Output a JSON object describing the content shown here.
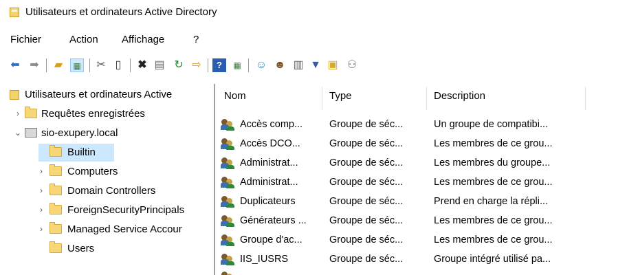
{
  "window": {
    "title": "Utilisateurs et ordinateurs Active Directory"
  },
  "menu": [
    "Fichier",
    "Action",
    "Affichage",
    "?"
  ],
  "toolbar": {
    "icons": [
      "back-arrow-icon",
      "forward-arrow-icon",
      "up-folder-icon",
      "show-tree-icon",
      "cut-icon",
      "paste-icon",
      "delete-icon",
      "properties-icon",
      "refresh-icon",
      "export-icon",
      "help-icon",
      "show-console-icon",
      "new-user-icon",
      "new-group-icon",
      "new-ou-icon",
      "filter-icon",
      "find-icon",
      "add-to-group-icon"
    ]
  },
  "tree": {
    "root": "Utilisateurs et ordinateurs Active",
    "saved_queries": "Requêtes enregistrées",
    "domain": "sio-exupery.local",
    "items": [
      "Builtin",
      "Computers",
      "Domain Controllers",
      "ForeignSecurityPrincipals",
      "Managed Service Accour",
      "Users"
    ],
    "selected": "Builtin"
  },
  "list": {
    "columns": [
      "Nom",
      "Type",
      "Description"
    ],
    "rows": [
      {
        "name": "Accès comp...",
        "type": "Groupe de séc...",
        "desc": "Un groupe de compatibi..."
      },
      {
        "name": "Accès DCO...",
        "type": "Groupe de séc...",
        "desc": "Les membres de ce grou..."
      },
      {
        "name": "Administrat...",
        "type": "Groupe de séc...",
        "desc": "Les membres du groupe..."
      },
      {
        "name": "Administrat...",
        "type": "Groupe de séc...",
        "desc": "Les membres de ce grou..."
      },
      {
        "name": "Duplicateurs",
        "type": "Groupe de séc...",
        "desc": "Prend en charge la répli..."
      },
      {
        "name": "Générateurs ...",
        "type": "Groupe de séc...",
        "desc": "Les membres de ce grou..."
      },
      {
        "name": "Groupe d'ac...",
        "type": "Groupe de séc...",
        "desc": "Les membres de ce grou..."
      },
      {
        "name": "IIS_IUSRS",
        "type": "Groupe de séc...",
        "desc": "Groupe intégré utilisé pa..."
      }
    ]
  },
  "colors": {
    "selection": "#cce8ff",
    "folder": "#f7d777",
    "nav_arrow": "#2b6cc4"
  }
}
